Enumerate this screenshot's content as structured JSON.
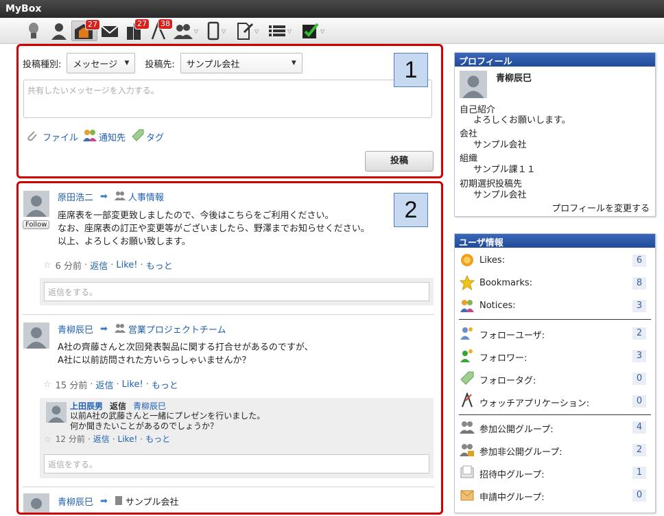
{
  "app": {
    "title": "MyBox"
  },
  "toolbar": {
    "badges": {
      "portal": "27",
      "building": "27",
      "watch": "38"
    }
  },
  "compose": {
    "type_label": "投稿種別:",
    "type_value": "メッセージ",
    "dest_label": "投稿先:",
    "dest_value": "サンプル会社",
    "placeholder": "共有したいメッセージを入力する。",
    "file_label": "ファイル",
    "notify_label": "通知先",
    "tag_label": "タグ",
    "submit_label": "投稿",
    "callout": "1"
  },
  "feed": {
    "callout": "2",
    "follow_label": "Follow",
    "reply_placeholder": "返信をする。",
    "posts": [
      {
        "author": "原田浩二",
        "target": "人事情報",
        "lines": [
          "座席表を一部変更致しましたので、今後はこちらをご利用ください。",
          "なお、座席表の訂正や変更等がございましたら、野澤までお知らせください。",
          "以上、よろしくお願い致します。"
        ],
        "time": "6 分前",
        "reply": "返信",
        "like": "Like!",
        "more": "もっと"
      },
      {
        "author": "青柳辰巳",
        "target": "営業プロジェクトチーム",
        "lines": [
          "A社の齊藤さんと次回発表製品に関する打合せがあるのですが、",
          "A社に以前訪問された方いらっしゃいませんか？"
        ],
        "time": "15 分前",
        "reply": "返信",
        "like": "Like!",
        "more": "もっと",
        "comment": {
          "author": "上田辰男",
          "verb": "返信",
          "to": "青柳辰巳",
          "lines": [
            "以前A社の武藤さんと一緒にプレゼンを行いました。",
            "何か聞きたいことがあるのでしょうか？"
          ],
          "time": "12 分前",
          "reply": "返信",
          "like": "Like!",
          "more": "もっと"
        }
      },
      {
        "author": "青柳辰巳",
        "target": "サンプル会社"
      }
    ]
  },
  "profile": {
    "header": "プロフィール",
    "name": "青柳辰巳",
    "intro_label": "自己紹介",
    "intro_value": "よろしくお願いします。",
    "company_label": "会社",
    "company_value": "サンプル会社",
    "org_label": "組織",
    "org_value": "サンプル課１１",
    "initial_label": "初期選択投稿先",
    "initial_value": "サンプル会社",
    "edit_link": "プロフィールを変更する"
  },
  "userinfo": {
    "header": "ユーザ情報",
    "items": [
      {
        "label": "Likes:",
        "count": "6"
      },
      {
        "label": "Bookmarks:",
        "count": "8"
      },
      {
        "label": "Notices:",
        "count": "3"
      },
      {
        "label": "フォローユーザ:",
        "count": "2"
      },
      {
        "label": "フォロワー:",
        "count": "3"
      },
      {
        "label": "フォロータグ:",
        "count": "0"
      },
      {
        "label": "ウォッチアプリケーション:",
        "count": "0"
      },
      {
        "label": "参加公開グループ:",
        "count": "4"
      },
      {
        "label": "参加非公開グループ:",
        "count": "2"
      },
      {
        "label": "招待中グループ:",
        "count": "1"
      },
      {
        "label": "申請中グループ:",
        "count": "0"
      }
    ]
  },
  "colors": {
    "accent": "#1e5fb3",
    "highlight": "#d00000",
    "panel_header": "#2a56a8"
  }
}
